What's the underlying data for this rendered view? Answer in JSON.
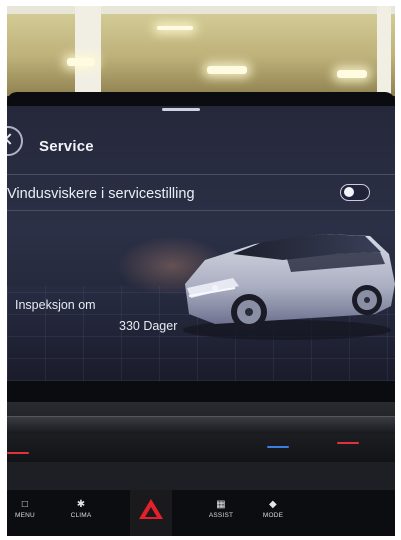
{
  "header": {
    "title": "Service"
  },
  "settings": {
    "wiper_service_label": "Vindusviskere i servicestilling",
    "wiper_service_enabled": false
  },
  "inspection": {
    "label": "Inspeksjon om",
    "value": "330 Dager"
  },
  "bottom_bar": {
    "menu_label": "MENU",
    "clima_label": "CLIMA",
    "assist_label": "ASSIST",
    "mode_label": "MODE"
  },
  "colors": {
    "screen_bg": "#2c3046",
    "hazard": "#e3202b",
    "led_red": "#e0323a",
    "led_blue": "#3b7de0"
  },
  "icons": {
    "back": "back-icon",
    "menu": "parking-menu-icon",
    "clima": "fan-icon",
    "hazard": "hazard-icon",
    "assist": "car-assist-icon",
    "mode": "car-mode-icon"
  }
}
